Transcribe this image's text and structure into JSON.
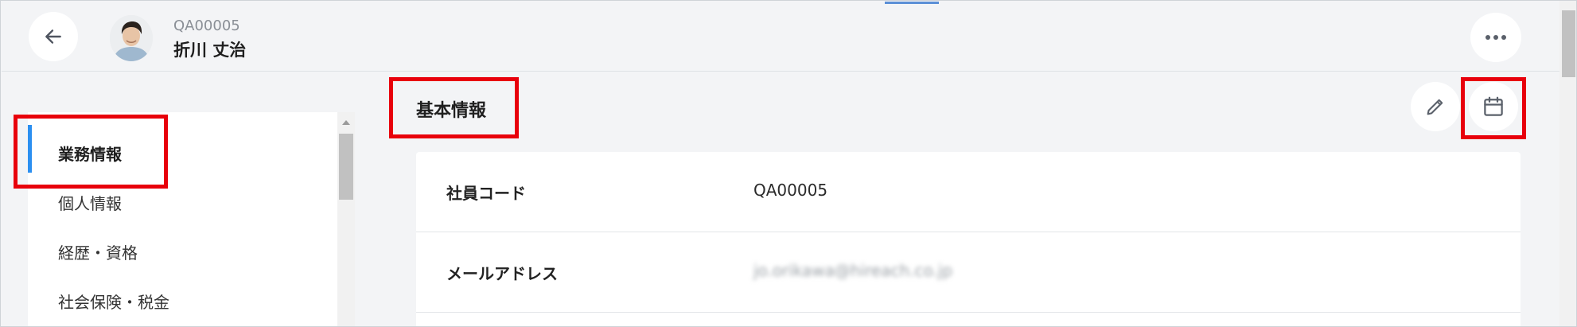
{
  "header": {
    "back_icon": "arrow-left-icon",
    "employee_code": "QA00005",
    "employee_name": "折川 丈治",
    "more_icon": "ellipsis-icon"
  },
  "sidebar": {
    "items": [
      {
        "label": "業務情報",
        "active": true
      },
      {
        "label": "個人情報",
        "active": false
      },
      {
        "label": "経歴・資格",
        "active": false
      },
      {
        "label": "社会保険・税金",
        "active": false
      }
    ]
  },
  "main": {
    "section_title": "基本情報",
    "edit_icon": "pencil-icon",
    "calendar_icon": "calendar-icon",
    "fields": [
      {
        "label": "社員コード",
        "value": "QA00005"
      },
      {
        "label": "メールアドレス",
        "value": "jo.orikawa@hireach.co.jp"
      }
    ]
  },
  "colors": {
    "accent": "#2b8ff0",
    "highlight": "#e8000b",
    "background": "#f3f4f6"
  }
}
